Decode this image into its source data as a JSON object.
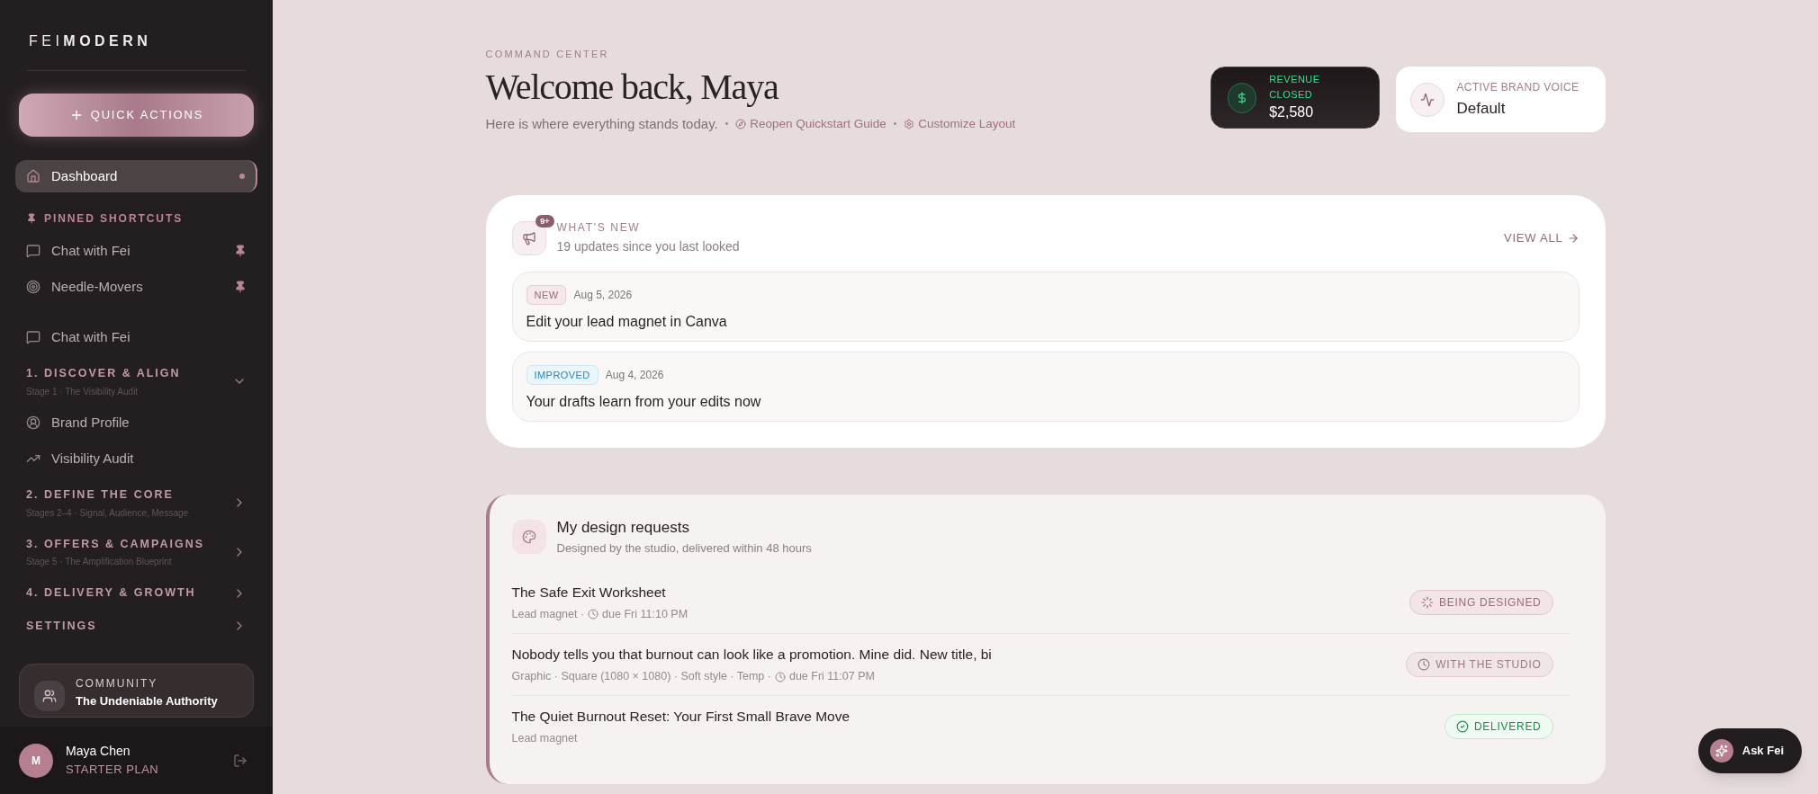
{
  "sidebar": {
    "logo_light": "FEI",
    "logo_bold": "MODERN",
    "quick_actions": "QUICK ACTIONS",
    "primary": [
      {
        "label": "Dashboard",
        "selected": true
      }
    ],
    "pinned_title": "PINNED SHORTCUTS",
    "pinned": [
      {
        "label": "Chat with Fei",
        "pinned": true
      },
      {
        "label": "Needle-Movers",
        "pinned": true
      }
    ],
    "links": [
      {
        "label": "Chat with Fei",
        "selected": false
      }
    ],
    "sections": [
      {
        "title": "1. DISCOVER & ALIGN",
        "subtitle": "Stage 1 · The Visibility Audit",
        "expanded": true,
        "children": [
          {
            "label": "Brand Profile",
            "selected": false
          },
          {
            "label": "Visibility Audit",
            "selected": false
          }
        ]
      },
      {
        "title": "2. DEFINE THE CORE",
        "subtitle": "Stages 2–4 · Signal, Audience, Message",
        "expanded": false
      },
      {
        "title": "3. OFFERS & CAMPAIGNS",
        "subtitle": "Stage 5 · The Amplification Blueprint",
        "expanded": false
      },
      {
        "title": "4. DELIVERY & GROWTH",
        "expanded": false
      },
      {
        "title": "SETTINGS",
        "expanded": false
      }
    ],
    "community": {
      "label": "COMMUNITY",
      "title": "The Undeniable Authority"
    },
    "user": {
      "initial": "M",
      "name": "Maya Chen",
      "plan": "STARTER PLAN"
    }
  },
  "header": {
    "eyebrow": "COMMAND CENTER",
    "title": "Welcome back, Maya",
    "subtitle": "Here is where everything stands today.",
    "links": [
      {
        "separator": "•",
        "label": "Reopen Quickstart Guide"
      },
      {
        "separator": "•",
        "label": "Customize Layout"
      }
    ]
  },
  "stats": [
    {
      "kind": "revenue",
      "label": "REVENUE CLOSED",
      "value": "$2,580"
    },
    {
      "kind": "voice",
      "label": "ACTIVE BRAND VOICE",
      "value": "Default"
    }
  ],
  "whats_new": {
    "badge": "9+",
    "title": "WHAT'S NEW",
    "subtitle": "19 updates since you last looked",
    "view_all": "VIEW ALL",
    "items": [
      {
        "kind": "new",
        "tag": "NEW",
        "date": "Aug 5, 2026",
        "title": "Edit your lead magnet in Canva"
      },
      {
        "kind": "improved",
        "tag": "IMPROVED",
        "date": "Aug 4, 2026",
        "title": "Your drafts learn from your edits now"
      }
    ]
  },
  "design_requests": {
    "title": "My design requests",
    "subtitle": "Designed by the studio, delivered within 48 hours",
    "rows": [
      {
        "title": "The Safe Exit Worksheet",
        "meta": "Lead magnet ·",
        "due": "due Fri 11:10 PM",
        "kind": "designing",
        "status": "BEING DESIGNED"
      },
      {
        "title": "Nobody tells you that burnout can look like a promotion. Mine did. New title, bi",
        "meta": "Graphic · Square (1080 × 1080) · Soft style · Temp ·",
        "due": "due Fri 11:07 PM",
        "kind": "studio",
        "status": "WITH THE STUDIO"
      },
      {
        "title": "The Quiet Burnout Reset: Your First Small Brave Move",
        "meta": "Lead magnet",
        "kind": "delivered",
        "status": "DELIVERED"
      }
    ]
  },
  "ask_fei": "Ask Fei"
}
